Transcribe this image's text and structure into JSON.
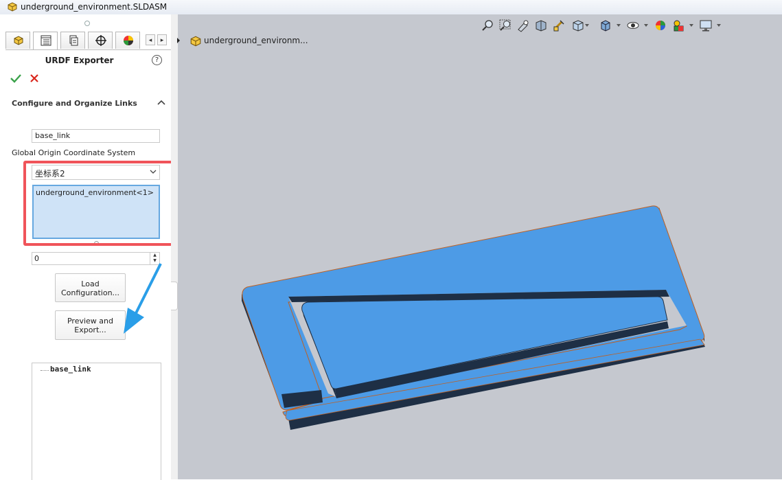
{
  "window": {
    "title": "underground_environment.SLDASM"
  },
  "panel": {
    "title": "URDF Exporter",
    "help_glyph": "?",
    "section_title": "Configure and Organize Links",
    "link_name_value": "base_link",
    "origin_label": "Global Origin Coordinate System",
    "origin_selected": "坐标系2",
    "selection_item": "underground_environment<1>",
    "spinner_value": "0",
    "load_button": "Load Configuration...",
    "preview_button": "Preview and Export...",
    "tree_root": "base_link",
    "tabs": [
      "feature-manager",
      "property-manager",
      "configuration-manager",
      "dimxpert-manager",
      "display-manager"
    ]
  },
  "viewport": {
    "breadcrumb": "underground_environm...",
    "toolbar_icons": [
      "zoom-to-fit-icon",
      "zoom-to-area-icon",
      "previous-view-icon",
      "section-view-icon",
      "dynamic-annotation-icon",
      "view-orientation-icon",
      "display-style-icon",
      "hide-show-icon",
      "edit-appearance-icon",
      "apply-scene-icon",
      "view-settings-icon"
    ]
  },
  "colors": {
    "model_top": "#4d9be6",
    "model_side": "#1e2f45",
    "highlight_box": "#f0545a",
    "callout_arrow": "#2a9ee8",
    "viewport_bg": "#c5c8cf"
  }
}
